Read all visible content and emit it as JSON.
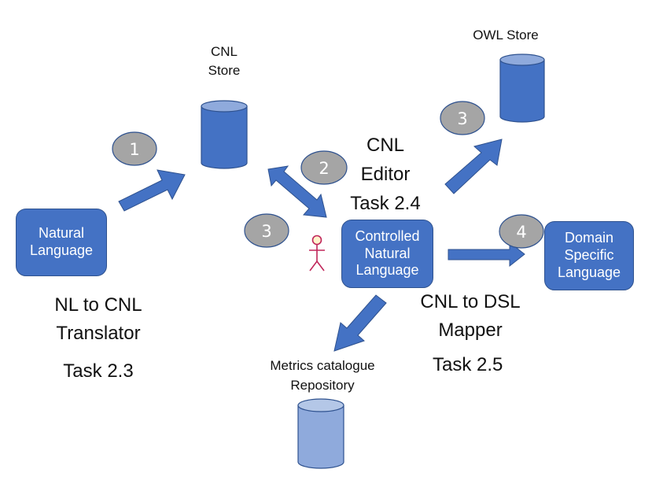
{
  "diagram": {
    "colors": {
      "primary": "#4472c4",
      "primary_border": "#2f528f",
      "cylinder_top": "#8faadc",
      "repo_fill": "#8faadc",
      "repo_top": "#b4c7e7",
      "badge_fill": "#a5a5a5",
      "badge_border": "#2f528f",
      "actor": "#c0265a",
      "actor_head": "#fff2cc"
    },
    "stores": {
      "cnl": {
        "label_line1": "CNL",
        "label_line2": "Store"
      },
      "owl": {
        "label": "OWL Store"
      },
      "metrics": {
        "label_line1": "Metrics catalogue",
        "label_line2": "Repository"
      }
    },
    "boxes": {
      "natural_language": {
        "line1": "Natural",
        "line2": "Language"
      },
      "controlled_natural_language": {
        "line1": "Controlled",
        "line2": "Natural",
        "line3": "Language"
      },
      "domain_specific_language": {
        "line1": "Domain",
        "line2": "Specific",
        "line3": "Language"
      }
    },
    "components": {
      "translator": {
        "line1": "NL to CNL",
        "line2": "Translator",
        "task": "Task 2.3"
      },
      "editor": {
        "line1": "CNL",
        "line2": "Editor",
        "task": "Task 2.4"
      },
      "mapper": {
        "line1": "CNL to DSL",
        "line2": "Mapper",
        "task": "Task 2.5"
      }
    },
    "steps": [
      {
        "id": "step-1",
        "label": "1"
      },
      {
        "id": "step-2",
        "label": "2"
      },
      {
        "id": "step-3-editor",
        "label": "3"
      },
      {
        "id": "step-3-owl",
        "label": "3"
      },
      {
        "id": "step-4",
        "label": "4"
      }
    ],
    "actor": {
      "icon": "stick-figure-user-icon"
    }
  }
}
